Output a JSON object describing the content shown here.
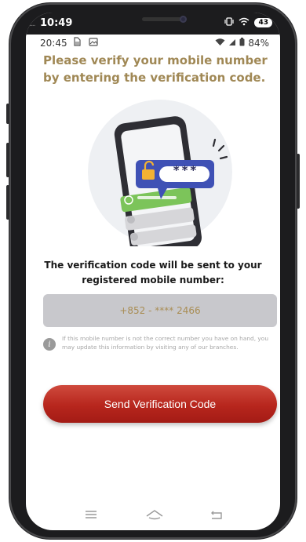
{
  "outer_status": {
    "time": "10:49",
    "signal_dots": "....",
    "battery": "43"
  },
  "inner_status": {
    "time": "20:45",
    "battery": "84%"
  },
  "heading": "Please verify your mobile number by entering the verification code.",
  "illustration": {
    "code_mask": "***",
    "icon": "lock-open-icon"
  },
  "description": "The verification code will be sent to your registered mobile number:",
  "mobile_number": "+852 - **** 2466",
  "info_note": "If this mobile number is not the correct number you have on hand, you may update this information by visiting any of our branches.",
  "send_button_label": "Send Verification Code",
  "colors": {
    "accent_gold": "#a08855",
    "button_red": "#b7261d",
    "number_box": "#c8c8cc",
    "bubble_blue": "#3f51b5",
    "green": "#7cc45a"
  },
  "nav_icons": [
    "menu-icon",
    "home-icon",
    "back-icon"
  ]
}
